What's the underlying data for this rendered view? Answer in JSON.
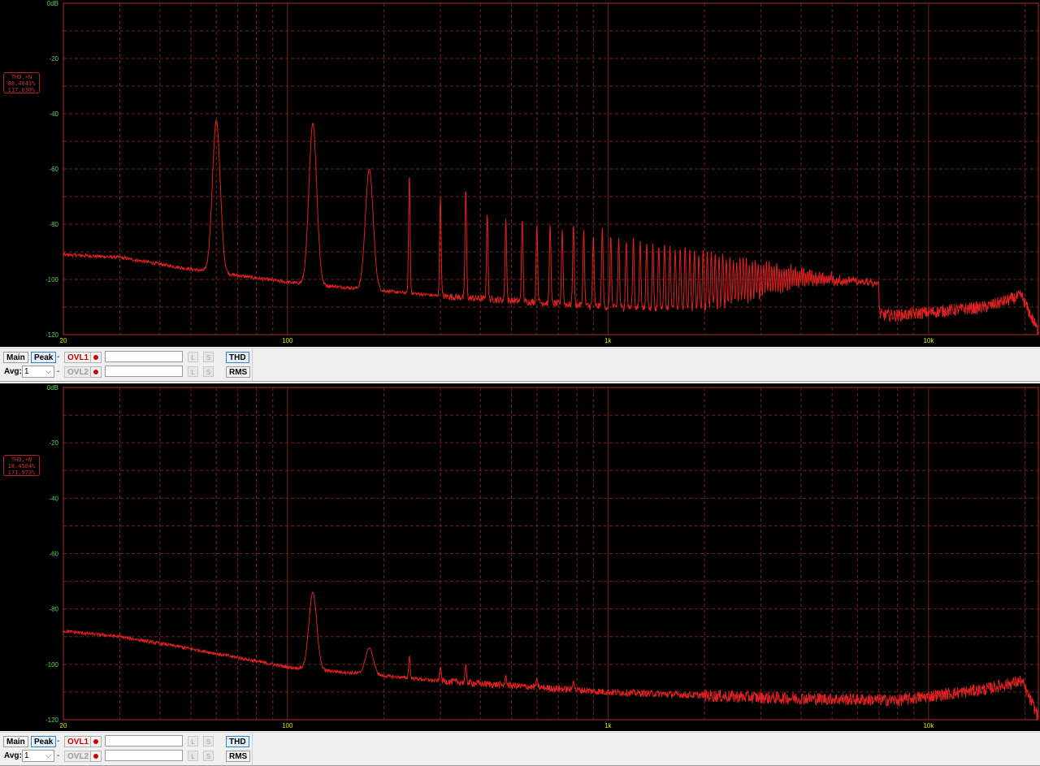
{
  "panels": [
    {
      "id": "top",
      "thd": {
        "label": "THD,+N",
        "value1": "88.4043%",
        "value2": "117.030%"
      },
      "toolbar": {
        "main_label": "Main",
        "peak_label": "Peak",
        "ovl1_label": "OVL1",
        "ovl2_label": "OVL2",
        "avg_label": "Avg:",
        "avg_value": "1",
        "l_label": "L",
        "s_label": "S",
        "thd_label": "THD",
        "rms_label": "RMS",
        "dash": "-"
      }
    },
    {
      "id": "bottom",
      "thd": {
        "label": "THD,+N",
        "value1": "18.4504%",
        "value2": "171.973%"
      },
      "toolbar": {
        "main_label": "Main",
        "peak_label": "Peak",
        "ovl1_label": "OVL1",
        "ovl2_label": "OVL2",
        "avg_label": "Avg:",
        "avg_value": "1",
        "l_label": "L",
        "s_label": "S",
        "thd_label": "THD",
        "rms_label": "RMS",
        "dash": "-"
      }
    }
  ],
  "axes": {
    "y_ticks": [
      "0dB",
      "-20",
      "-40",
      "-60",
      "-80",
      "-100",
      "-120"
    ],
    "x_ticks": [
      "20",
      "100",
      "1k",
      "10k"
    ]
  },
  "colors": {
    "trace": "#e02020",
    "grid": "#7a1f1f",
    "frame": "#b03030",
    "y_label": "#5fcf5f",
    "x_label": "#e0e000",
    "background": "#000000"
  },
  "chart_data": [
    {
      "type": "line",
      "title": "",
      "xlabel": "",
      "ylabel": "",
      "x_scale": "log",
      "xlim": [
        20,
        22000
      ],
      "ylim": [
        -120,
        0
      ],
      "grid": true,
      "series": [
        {
          "noise_floor": [
            [
              20,
              -91
            ],
            [
              30,
              -92
            ],
            [
              48,
              -96
            ],
            [
              100,
              -101
            ],
            [
              300,
              -106
            ],
            [
              1000,
              -110
            ],
            [
              3000,
              -112
            ],
            [
              8000,
              -113
            ],
            [
              15000,
              -110
            ],
            [
              19500,
              -106
            ],
            [
              22000,
              -119
            ]
          ],
          "peaks": [
            [
              60,
              -42.5
            ],
            [
              120,
              -43.5
            ],
            [
              180,
              -60
            ],
            [
              240,
              -62
            ],
            [
              300,
              -70
            ],
            [
              360,
              -67
            ],
            [
              420,
              -76
            ],
            [
              480,
              -78
            ],
            [
              540,
              -78
            ],
            [
              600,
              -80
            ],
            [
              660,
              -80
            ],
            [
              720,
              -82
            ],
            [
              780,
              -80
            ],
            [
              840,
              -82
            ],
            [
              900,
              -84
            ],
            [
              960,
              -81
            ],
            [
              1020,
              -84
            ],
            [
              1080,
              -85
            ],
            [
              1140,
              -86
            ],
            [
              1200,
              -85
            ],
            [
              1260,
              -86
            ],
            [
              1320,
              -87
            ],
            [
              1380,
              -87
            ],
            [
              1440,
              -88
            ],
            [
              1500,
              -87
            ]
          ],
          "peaks_note_continued_to_hz": 7000
        }
      ]
    },
    {
      "type": "line",
      "title": "",
      "xlabel": "",
      "ylabel": "",
      "x_scale": "log",
      "xlim": [
        20,
        22000
      ],
      "ylim": [
        -120,
        0
      ],
      "grid": true,
      "series": [
        {
          "noise_floor": [
            [
              20,
              -88
            ],
            [
              30,
              -90
            ],
            [
              48,
              -94
            ],
            [
              100,
              -101
            ],
            [
              300,
              -106
            ],
            [
              1000,
              -110
            ],
            [
              3000,
              -112
            ],
            [
              8000,
              -113
            ],
            [
              15000,
              -109
            ],
            [
              19500,
              -106
            ],
            [
              22000,
              -119
            ]
          ],
          "peaks": [
            [
              120,
              -74
            ],
            [
              180,
              -94
            ],
            [
              240,
              -97
            ],
            [
              300,
              -101
            ],
            [
              360,
              -100
            ],
            [
              480,
              -104
            ],
            [
              600,
              -105
            ],
            [
              780,
              -106
            ]
          ]
        }
      ]
    }
  ]
}
